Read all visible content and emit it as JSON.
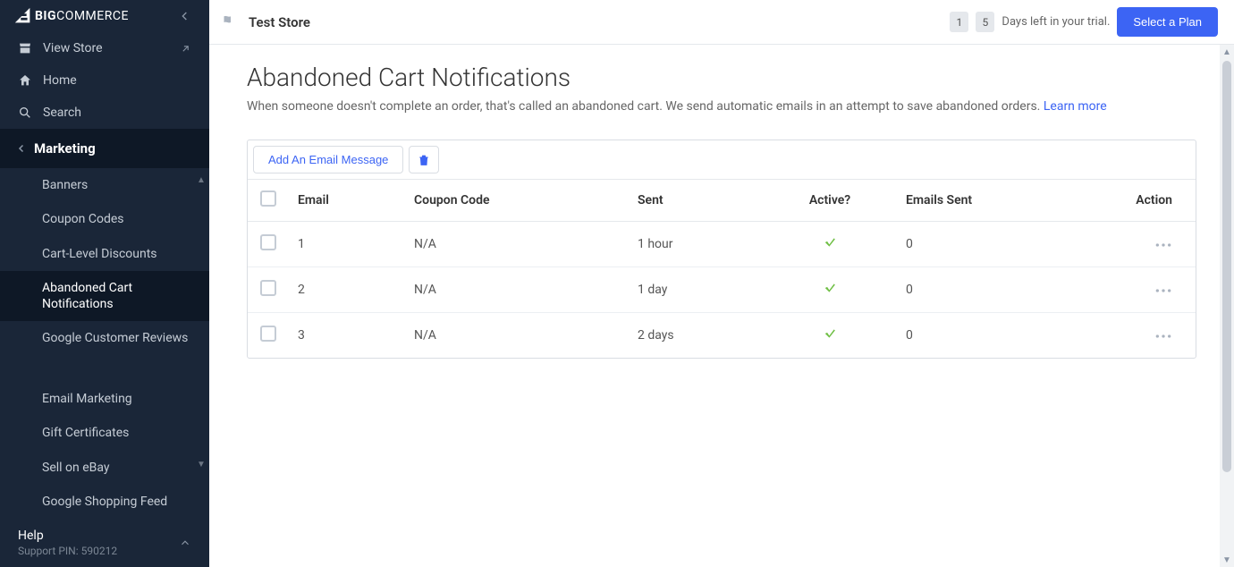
{
  "brand": {
    "part1": "BIG",
    "part2": "COMMERCE"
  },
  "primary_nav": {
    "view_store": "View Store",
    "home": "Home",
    "search": "Search"
  },
  "section": {
    "label": "Marketing"
  },
  "subnav": {
    "banners": "Banners",
    "coupon_codes": "Coupon Codes",
    "cart_discounts": "Cart-Level Discounts",
    "abandoned_cart": "Abandoned Cart Notifications",
    "google_reviews": "Google Customer Reviews",
    "email_marketing": "Email Marketing",
    "gift_certificates": "Gift Certificates",
    "sell_ebay": "Sell on eBay",
    "google_shopping": "Google Shopping Feed"
  },
  "help": {
    "label": "Help",
    "pin": "Support PIN: 590212"
  },
  "topbar": {
    "store_name": "Test Store",
    "day1": "1",
    "day2": "5",
    "trial_text": "Days left in your trial.",
    "select_plan": "Select a Plan"
  },
  "page": {
    "title": "Abandoned Cart Notifications",
    "desc": "When someone doesn't complete an order, that's called an abandoned cart. We send automatic emails in an attempt to save abandoned orders. ",
    "learn_more": "Learn more"
  },
  "toolbar": {
    "add": "Add An Email Message"
  },
  "table": {
    "headers": {
      "email": "Email",
      "coupon": "Coupon Code",
      "sent": "Sent",
      "active": "Active?",
      "emails_sent": "Emails Sent",
      "action": "Action"
    },
    "rows": [
      {
        "email": "1",
        "coupon": "N/A",
        "sent": "1 hour",
        "active": true,
        "emails_sent": "0"
      },
      {
        "email": "2",
        "coupon": "N/A",
        "sent": "1 day",
        "active": true,
        "emails_sent": "0"
      },
      {
        "email": "3",
        "coupon": "N/A",
        "sent": "2 days",
        "active": true,
        "emails_sent": "0"
      }
    ]
  }
}
